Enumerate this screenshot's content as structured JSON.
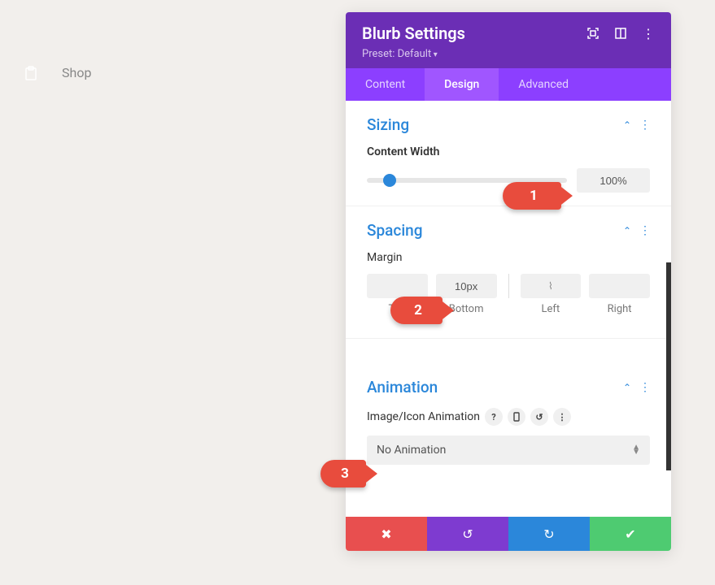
{
  "shop": {
    "label": "Shop"
  },
  "panel": {
    "title": "Blurb Settings",
    "preset": "Preset: Default"
  },
  "tabs": {
    "content": "Content",
    "design": "Design",
    "advanced": "Advanced",
    "active": "design"
  },
  "sizing": {
    "title": "Sizing",
    "content_width_label": "Content Width",
    "content_width_value": "100%"
  },
  "spacing": {
    "title": "Spacing",
    "margin_label": "Margin",
    "top": {
      "label": "Top",
      "value": ""
    },
    "bottom": {
      "label": "Bottom",
      "value": "10px"
    },
    "left": {
      "label": "Left",
      "value": ""
    },
    "right": {
      "label": "Right",
      "value": ""
    }
  },
  "animation": {
    "title": "Animation",
    "field_label": "Image/Icon Animation",
    "selected": "No Animation"
  },
  "callouts": {
    "one": "1",
    "two": "2",
    "three": "3"
  }
}
